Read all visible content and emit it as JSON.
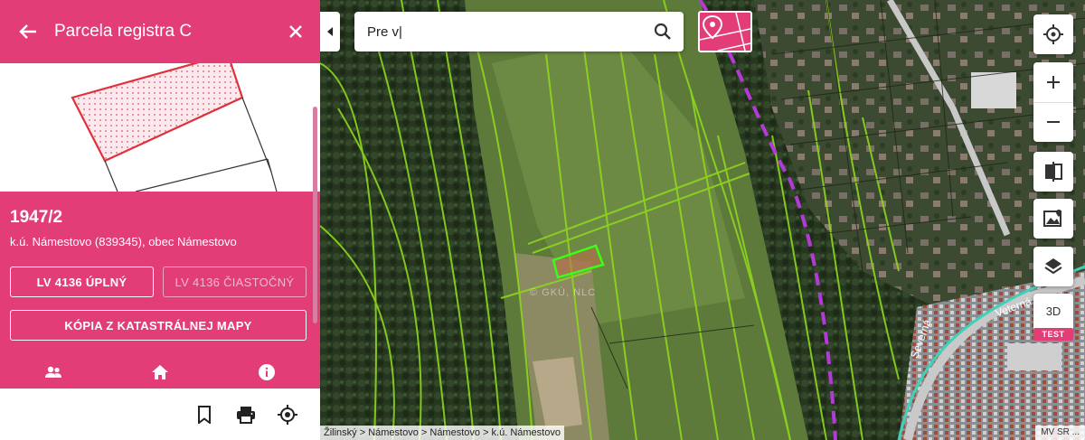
{
  "panel": {
    "title": "Parcela registra C",
    "parcel_number": "1947/2",
    "location": "k.ú. Námestovo (839345), obec Námestovo",
    "btn_lv_full": "LV 4136 ÚPLNÝ",
    "btn_lv_partial": "LV 4136 ČIASTOČNÝ",
    "btn_map_copy": "KÓPIA Z KATASTRÁLNEJ MAPY"
  },
  "map": {
    "search_value": "Pre v|",
    "ctrl_3d": "3D",
    "ctrl_test_badge": "TEST",
    "breadcrumb": "Žilinský > Námestovo > Námestovo > k.ú. Námestovo",
    "attribution": "MV SR ...",
    "watermark": "© GKÚ, NLC",
    "street_1": "Veterná",
    "street_2": "Severná"
  },
  "colors": {
    "accent": "#e33d78",
    "parcel_outline": "#e0303a",
    "parcel_lines": "#8ed61e",
    "selected_parcel": "#39ff14",
    "boundary": "#b23ad6"
  },
  "icons": {
    "back": "arrow-left-icon",
    "close": "close-icon",
    "search": "search-icon",
    "collapse": "chevron-left-icon",
    "locate": "crosshair-icon",
    "zoom_in": "plus-icon",
    "zoom_out": "minus-icon",
    "compare": "compare-icon",
    "map_layer": "map-image-icon",
    "layers": "layers-icon",
    "owners": "people-icon",
    "home": "home-icon",
    "info": "info-icon",
    "bookmark": "bookmark-icon",
    "print": "print-icon",
    "locate_parcel": "target-icon"
  }
}
